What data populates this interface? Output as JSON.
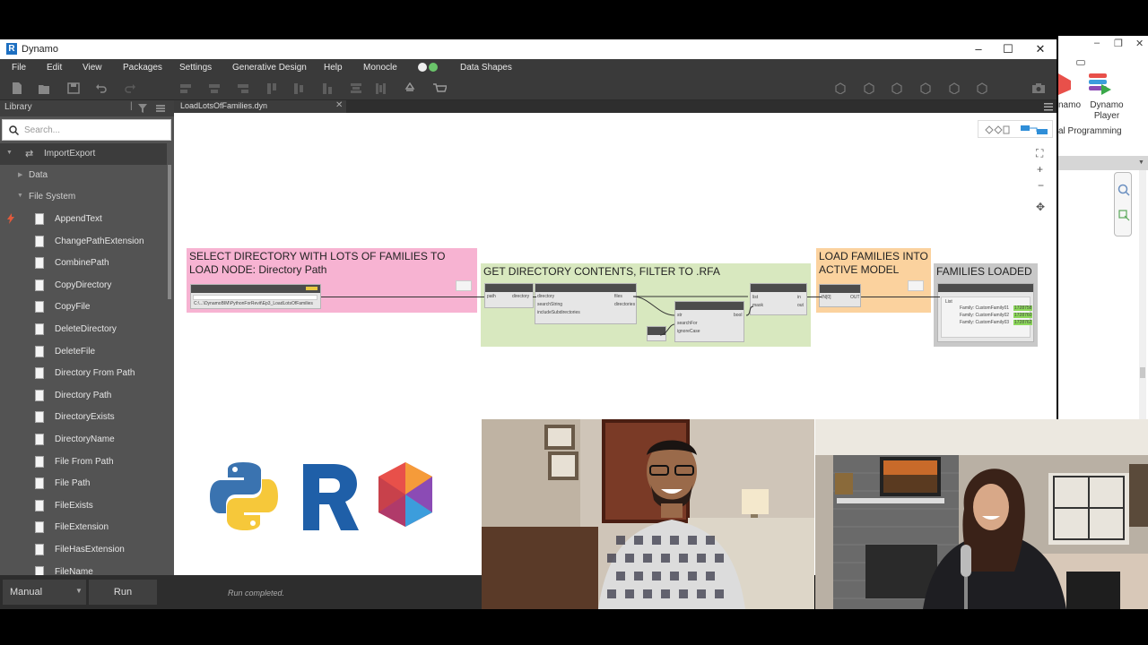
{
  "window": {
    "title": "Dynamo",
    "minimize": "–",
    "maximize": "☐",
    "close": "✕"
  },
  "menu": [
    "File",
    "Edit",
    "View",
    "Packages",
    "Settings",
    "Generative Design",
    "Help",
    "Monocle",
    "Data Shapes"
  ],
  "library": {
    "header": "Library",
    "search_placeholder": "Search...",
    "top_category": "ImportExport",
    "subcategories": [
      "Data",
      "File System"
    ],
    "items": [
      "AppendText",
      "ChangePathExtension",
      "CombinePath",
      "CopyDirectory",
      "CopyFile",
      "DeleteDirectory",
      "DeleteFile",
      "Directory From Path",
      "Directory Path",
      "DirectoryExists",
      "DirectoryName",
      "File From Path",
      "File Path",
      "FileExists",
      "FileExtension",
      "FileHasExtension",
      "FileName"
    ]
  },
  "tab": {
    "label": "LoadLotsOfFamilies.dyn",
    "close": "✕"
  },
  "groups": {
    "select": "SELECT DIRECTORY WITH LOTS OF FAMILIES TO LOAD NODE: Directory Path",
    "contents": "GET DIRECTORY CONTENTS, FILTER TO .RFA",
    "load": "LOAD FAMILIES INTO ACTIVE MODEL",
    "loaded": "FAMILIES LOADED"
  },
  "nodes": {
    "path_value": "C:\\...\\DynamoBIM\\PythonForRevit\\Ep3_LoadLotsOfFamilies",
    "dir_ports_in": [
      "directory",
      "searchString",
      "includeSubdirectories"
    ],
    "dir_ports_out": [
      "files",
      "directories"
    ],
    "contains_ports_in": [
      "str",
      "searchFor",
      "ignoreCase"
    ],
    "contains_out": "bool",
    "mask_in": [
      "list",
      "mask"
    ],
    "mask_out": [
      "in",
      "out"
    ],
    "path_in": "path",
    "path_out": "directory",
    "python_in": "IN[0]",
    "python_out": "OUT",
    "watch_items": [
      "Family: CustomFamily01",
      "Family: CustomFamily02",
      "Family: CustomFamily03"
    ],
    "watch_ids": [
      "1728758",
      "1728760",
      "1728762"
    ],
    "watch_list": "List"
  },
  "bottom": {
    "run_mode": "Manual",
    "run_button": "Run",
    "status": "Run completed."
  },
  "revit": {
    "player_label": "Dynamo Player",
    "dynamo_partial": "namo",
    "visual_partial": "al Programming"
  },
  "colors": {
    "group_select": "#f7b3d2",
    "group_contents": "#d8e8bf",
    "group_load": "#fbd29e",
    "group_loaded": "#c8c8c8"
  }
}
